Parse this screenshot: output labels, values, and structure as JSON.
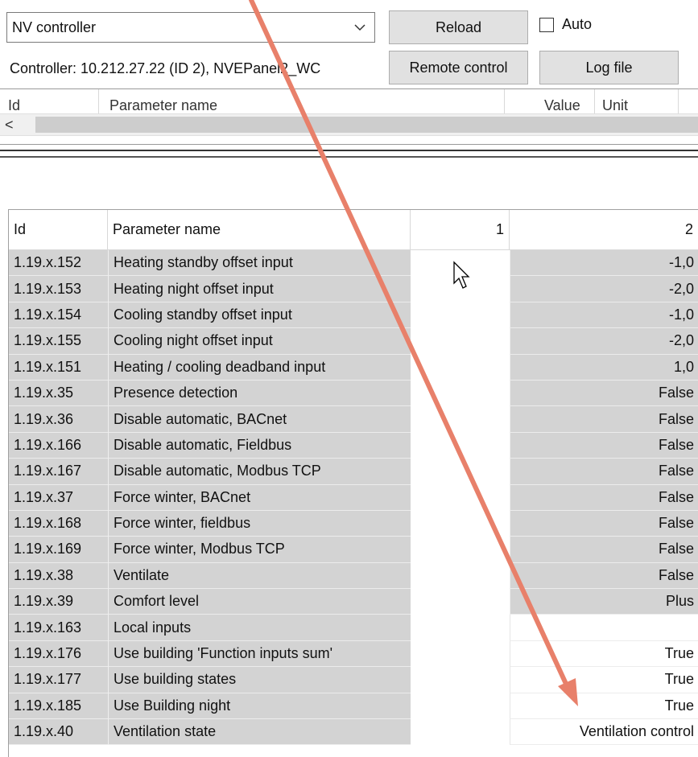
{
  "toolbar": {
    "controller_select": "NV controller",
    "reload_label": "Reload",
    "auto_label": "Auto",
    "remote_control_label": "Remote control",
    "log_file_label": "Log file",
    "controller_info": "Controller: 10.212.27.22 (ID 2), NVEPanel2_WC"
  },
  "upper_list": {
    "columns": [
      "Id",
      "Parameter name",
      "Value",
      "Unit"
    ],
    "scroll_left_icon": "chevron-left-icon"
  },
  "grid": {
    "columns": [
      "Id",
      "Parameter name",
      "1",
      "2"
    ],
    "rows": [
      {
        "id": "1.19.x.152",
        "name": "Heating standby offset input",
        "v1": "",
        "v2": "-1,0"
      },
      {
        "id": "1.19.x.153",
        "name": "Heating night offset input",
        "v1": "",
        "v2": "-2,0"
      },
      {
        "id": "1.19.x.154",
        "name": "Cooling standby offset input",
        "v1": "",
        "v2": "-1,0"
      },
      {
        "id": "1.19.x.155",
        "name": "Cooling night offset input",
        "v1": "",
        "v2": "-2,0"
      },
      {
        "id": "1.19.x.151",
        "name": "Heating / cooling deadband input",
        "v1": "",
        "v2": "1,0"
      },
      {
        "id": "1.19.x.35",
        "name": "Presence detection",
        "v1": "",
        "v2": "False"
      },
      {
        "id": "1.19.x.36",
        "name": "Disable automatic, BACnet",
        "v1": "",
        "v2": "False"
      },
      {
        "id": "1.19.x.166",
        "name": "Disable automatic, Fieldbus",
        "v1": "",
        "v2": "False"
      },
      {
        "id": "1.19.x.167",
        "name": "Disable automatic, Modbus TCP",
        "v1": "",
        "v2": "False"
      },
      {
        "id": "1.19.x.37",
        "name": "Force winter, BACnet",
        "v1": "",
        "v2": "False"
      },
      {
        "id": "1.19.x.168",
        "name": "Force winter, fieldbus",
        "v1": "",
        "v2": "False"
      },
      {
        "id": "1.19.x.169",
        "name": "Force winter, Modbus TCP",
        "v1": "",
        "v2": "False"
      },
      {
        "id": "1.19.x.38",
        "name": "Ventilate",
        "v1": "",
        "v2": "False"
      },
      {
        "id": "1.19.x.39",
        "name": "Comfort level",
        "v1": "",
        "v2": "Plus"
      },
      {
        "id": "1.19.x.163",
        "name": "Local inputs",
        "v1": "",
        "v2": ""
      },
      {
        "id": "1.19.x.176",
        "name": "Use building 'Function inputs sum'",
        "v1": "",
        "v2": "True"
      },
      {
        "id": "1.19.x.177",
        "name": "Use building states",
        "v1": "",
        "v2": "True"
      },
      {
        "id": "1.19.x.185",
        "name": "Use Building night",
        "v1": "",
        "v2": "True"
      },
      {
        "id": "1.19.x.40",
        "name": "Ventilation state",
        "v1": "",
        "v2": "Ventilation control"
      }
    ]
  },
  "annotation": {
    "arrow_color": "#e8806a",
    "icon": "arrow-annotation-icon"
  },
  "cursor_icon": "mouse-pointer-icon"
}
